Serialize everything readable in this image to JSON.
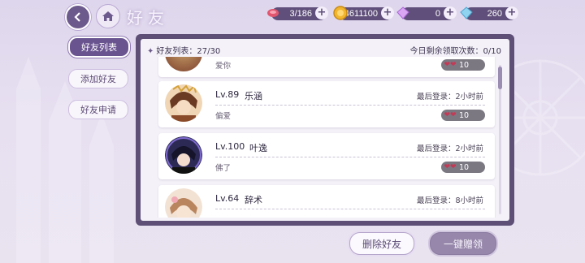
{
  "header": {
    "title": "好友",
    "resources": [
      {
        "name": "stamina",
        "icon": "candy-icon",
        "value": "3/186"
      },
      {
        "name": "gold",
        "icon": "coin-icon",
        "value": "4611100"
      },
      {
        "name": "diamond-pink",
        "icon": "pink-diamond-icon",
        "value": "0"
      },
      {
        "name": "diamond-blue",
        "icon": "blue-diamond-icon",
        "value": "260"
      }
    ]
  },
  "tabs": [
    {
      "label": "好友列表",
      "active": true
    },
    {
      "label": "添加好友",
      "active": false
    },
    {
      "label": "好友申请",
      "active": false
    }
  ],
  "list": {
    "title": "好友列表：27/30",
    "remaining": "今日剩余领取次数：0/10"
  },
  "friends": [
    {
      "level": "",
      "name": "",
      "last_login": "",
      "motto": "爱你",
      "gift": "10"
    },
    {
      "level": "Lv.89",
      "name": "乐涵",
      "last_login": "最后登录：2小时前",
      "motto": "偏爱",
      "gift": "10"
    },
    {
      "level": "Lv.100",
      "name": "叶逸",
      "last_login": "最后登录：2小时前",
      "motto": "佛了",
      "gift": "10"
    },
    {
      "level": "Lv.64",
      "name": "辞术",
      "last_login": "最后登录：8小时前",
      "motto": "",
      "gift": ""
    }
  ],
  "buttons": {
    "delete": "删除好友",
    "claim_all": "一键赠领"
  },
  "colors": {
    "panel": "#5d4f76",
    "accent": "#6a5490",
    "gift_heart": "#c23a55"
  }
}
